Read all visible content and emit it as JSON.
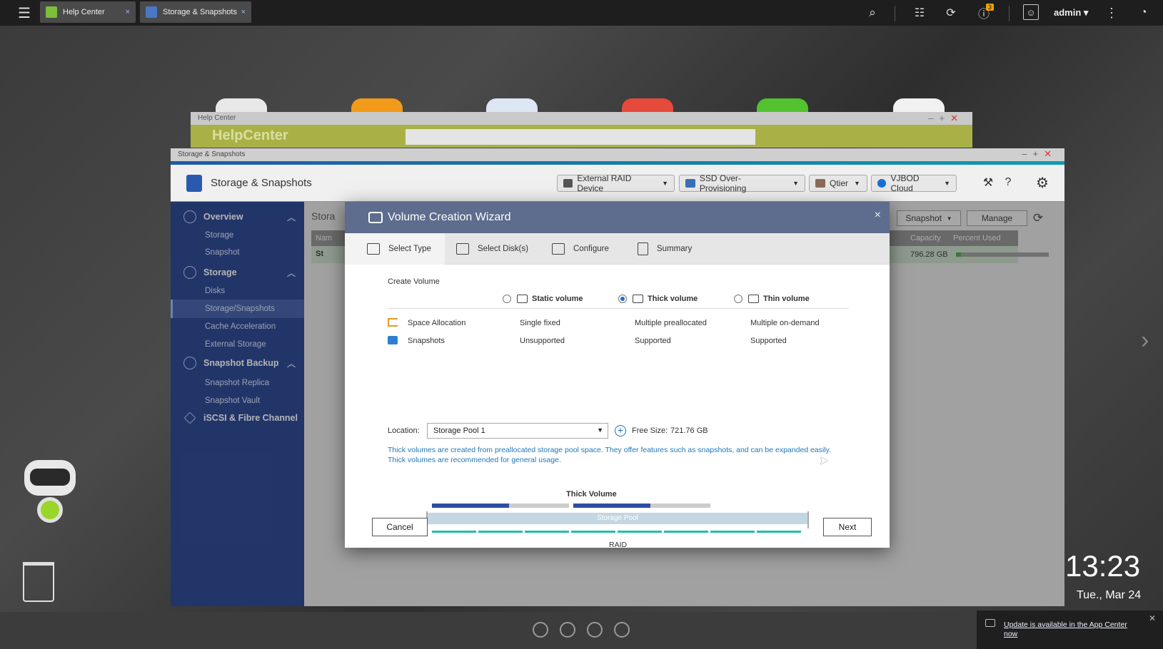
{
  "topbar": {
    "tabs": [
      {
        "label": "Help Center",
        "close": "×"
      },
      {
        "label": "Storage & Snapshots",
        "close": "×"
      }
    ],
    "notification_count": "3",
    "user": "admin ▾"
  },
  "help_window": {
    "header": "Help Center",
    "title": "HelpCenter"
  },
  "storage_window": {
    "header": "Storage & Snapshots",
    "app_title": "Storage & Snapshots",
    "toolbar": [
      {
        "label": "External RAID Device"
      },
      {
        "label": "SSD Over-Provisioning"
      },
      {
        "label": "Qtier"
      },
      {
        "label": "VJBOD Cloud"
      }
    ],
    "sidebar": {
      "overview": "Overview",
      "storage_sub": "Storage",
      "snapshot_sub": "Snapshot",
      "storage": "Storage",
      "disks": "Disks",
      "storage_snapshots": "Storage/Snapshots",
      "cache": "Cache Acceleration",
      "external": "External Storage",
      "snapshot_backup": "Snapshot Backup",
      "replica": "Snapshot Replica",
      "vault": "Snapshot Vault",
      "iscsi": "iSCSI & Fibre Channel"
    },
    "content": {
      "title": "Stora",
      "snapshot_btn": "Snapshot",
      "manage_btn": "Manage",
      "col_name": "Nam",
      "col_capacity": "Capacity",
      "col_percent": "Percent Used",
      "row_name": "St",
      "row_capacity": "796.28 GB",
      "percent_used": 0.05
    }
  },
  "wizard": {
    "title": "Volume Creation Wizard",
    "close": "×",
    "steps": [
      "Select Type",
      "Select Disk(s)",
      "Configure",
      "Summary"
    ],
    "create_volume": "Create Volume",
    "options": [
      "Static volume",
      "Thick volume",
      "Thin volume"
    ],
    "selected": "Thick volume",
    "features": [
      {
        "label": "Space Allocation",
        "values": [
          "Single fixed",
          "Multiple preallocated",
          "Multiple on-demand"
        ]
      },
      {
        "label": "Snapshots",
        "values": [
          "Unsupported",
          "Supported",
          "Supported"
        ]
      }
    ],
    "location_label": "Location:",
    "location_value": "Storage Pool 1",
    "free_size_label": "Free Size:",
    "free_size_value": "721.76 GB",
    "description": "Thick volumes are created from preallocated storage pool space. They offer features such as snapshots, and can be expanded easily. Thick volumes are recommended for general usage.",
    "diagram": {
      "title": "Thick Volume",
      "pool_label": "Storage Pool",
      "raid_label": "RAID"
    },
    "cancel": "Cancel",
    "next": "Next"
  },
  "desktop": {
    "time": "13:23",
    "date": "Tue., Mar 24",
    "notification": "Update is available in the App Center now"
  },
  "colors": {
    "accent": "#1f3d8c",
    "wizard_header": "#5e6c8d",
    "teal": "#1fc0a8"
  }
}
